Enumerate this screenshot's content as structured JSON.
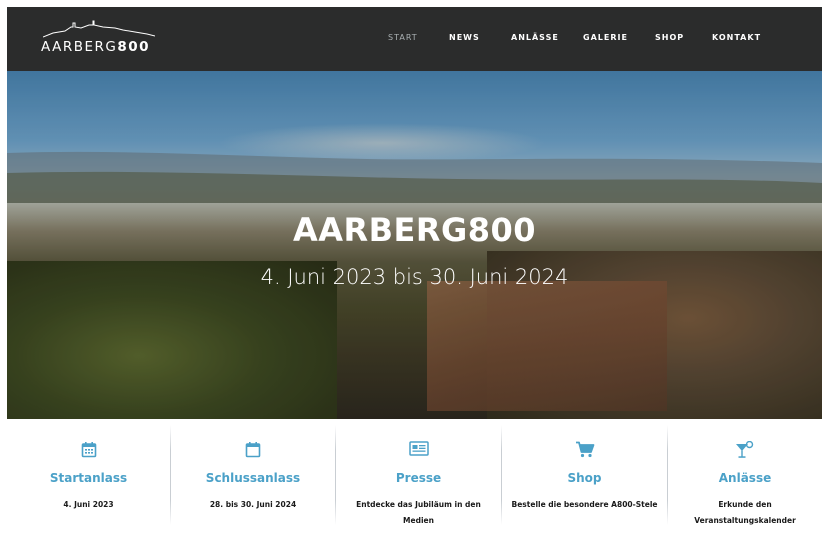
{
  "header": {
    "logo_text_light": "AARBERG",
    "logo_text_bold": "800",
    "nav": [
      {
        "label": "START",
        "active": true
      },
      {
        "label": "NEWS"
      },
      {
        "label": "ANLÄSSE"
      },
      {
        "label": "GALERIE"
      },
      {
        "label": "SHOP"
      },
      {
        "label": "KONTAKT"
      }
    ]
  },
  "hero": {
    "title": "AARBERG800",
    "subtitle": "4. Juni 2023 bis 30. Juni 2024"
  },
  "features": [
    {
      "icon": "calendar-icon",
      "title": "Startanlass",
      "desc": "4. Juni 2023"
    },
    {
      "icon": "calendar-icon",
      "title": "Schlussanlass",
      "desc": "28. bis 30. Juni 2024"
    },
    {
      "icon": "newspaper-icon",
      "title": "Presse",
      "desc": "Entdecke das Jubiläum in den Medien"
    },
    {
      "icon": "cart-icon",
      "title": "Shop",
      "desc": "Bestelle die besondere A800-Stele"
    },
    {
      "icon": "cocktail-icon",
      "title": "Anlässe",
      "desc": "Erkunde den Veranstaltungskalender"
    }
  ],
  "colors": {
    "header_bg": "#2b2c2c",
    "accent": "#4ba1c8",
    "nav_active": "#a9b0b2"
  }
}
